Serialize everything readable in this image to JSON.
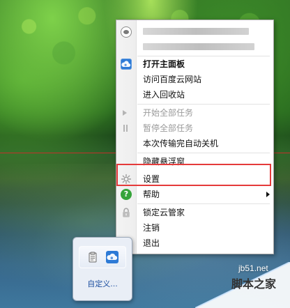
{
  "menu": {
    "header_redacted": true,
    "items": [
      {
        "label": "打开主面板"
      },
      {
        "label": "访问百度云网站"
      },
      {
        "label": "进入回收站"
      },
      {
        "label": "开始全部任务"
      },
      {
        "label": "暂停全部任务"
      },
      {
        "label": "本次传输完自动关机"
      },
      {
        "label": "隐藏悬浮窗"
      },
      {
        "label": "设置"
      },
      {
        "label": "帮助"
      },
      {
        "label": "锁定云管家"
      },
      {
        "label": "注销"
      },
      {
        "label": "退出"
      }
    ]
  },
  "tray": {
    "custom_label": "自定义..."
  },
  "watermark": {
    "site": "jb51.net",
    "name": "脚本之家"
  },
  "colors": {
    "highlight": "#e53a3a",
    "cloud_blue": "#2d7ad6",
    "help_green": "#35a43a",
    "exit_red": "#d73a32"
  }
}
